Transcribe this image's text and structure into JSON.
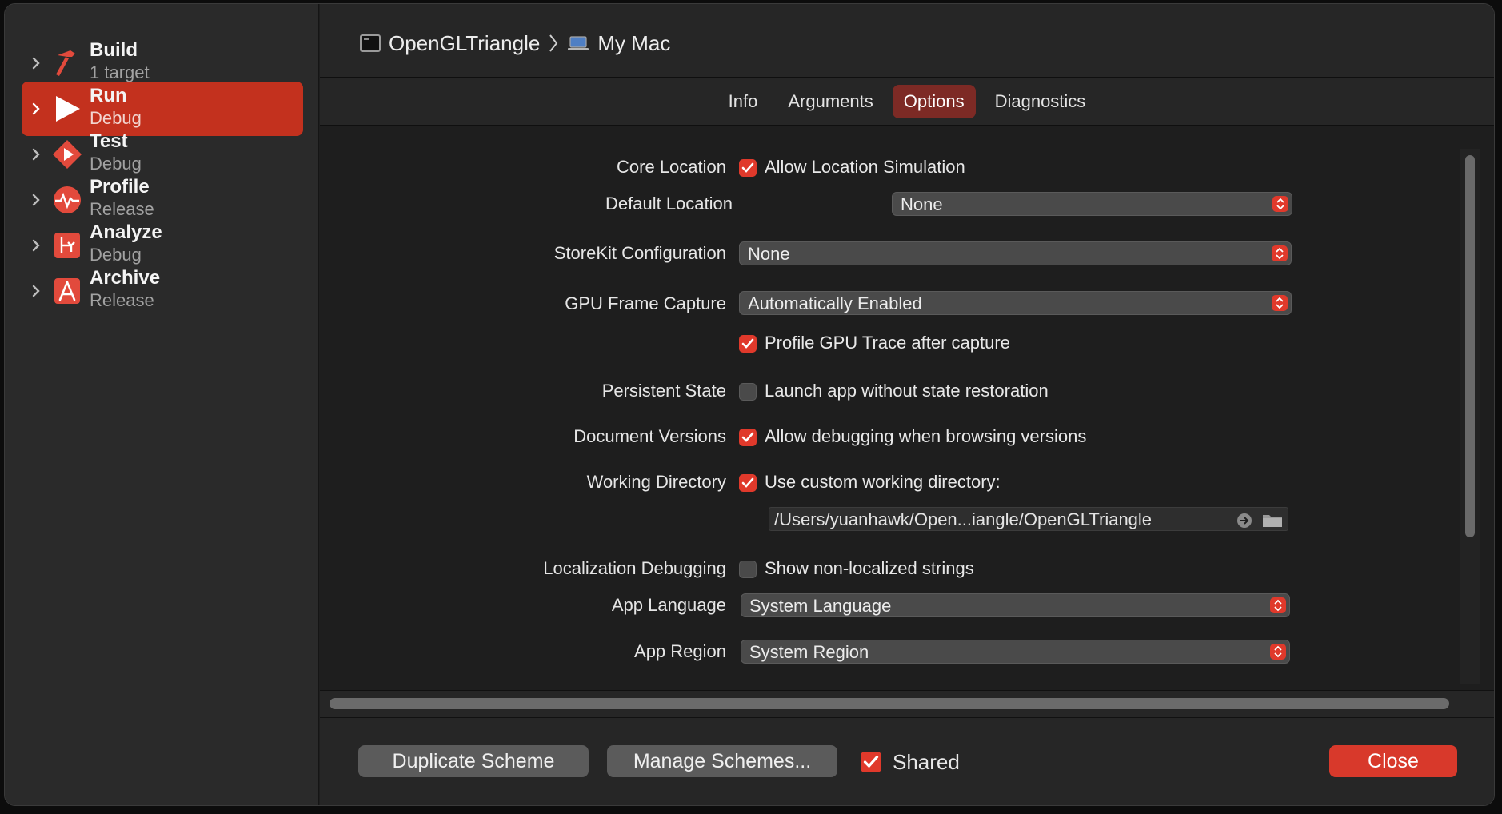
{
  "sidebar": {
    "items": [
      {
        "title": "Build",
        "subtitle": "1 target"
      },
      {
        "title": "Run",
        "subtitle": "Debug"
      },
      {
        "title": "Test",
        "subtitle": "Debug"
      },
      {
        "title": "Profile",
        "subtitle": "Release"
      },
      {
        "title": "Analyze",
        "subtitle": "Debug"
      },
      {
        "title": "Archive",
        "subtitle": "Release"
      }
    ]
  },
  "header": {
    "scheme_name": "OpenGLTriangle",
    "destination": "My Mac"
  },
  "tabs": [
    "Info",
    "Arguments",
    "Options",
    "Diagnostics"
  ],
  "active_tab": "Options",
  "options": {
    "core_location": {
      "label": "Core Location",
      "checkbox_label": "Allow Location Simulation",
      "checked": true,
      "default_location_label": "Default Location",
      "default_location_value": "None"
    },
    "storekit": {
      "label": "StoreKit Configuration",
      "value": "None"
    },
    "gpu_frame_capture": {
      "label": "GPU Frame Capture",
      "value": "Automatically Enabled",
      "checkbox_label": "Profile GPU Trace after capture",
      "checked": true
    },
    "persistent_state": {
      "label": "Persistent State",
      "checkbox_label": "Launch app without state restoration",
      "checked": false
    },
    "document_versions": {
      "label": "Document Versions",
      "checkbox_label": "Allow debugging when browsing versions",
      "checked": true
    },
    "working_directory": {
      "label": "Working Directory",
      "checkbox_label": "Use custom working directory:",
      "checked": true,
      "path": "/Users/yuanhawk/Open...iangle/OpenGLTriangle"
    },
    "localization_debugging": {
      "label": "Localization Debugging",
      "checkbox_label": "Show non-localized strings",
      "checked": false
    },
    "app_language": {
      "label": "App Language",
      "value": "System Language"
    },
    "app_region": {
      "label": "App Region",
      "value": "System Region"
    }
  },
  "footer": {
    "duplicate_label": "Duplicate Scheme",
    "manage_label": "Manage Schemes...",
    "shared_label": "Shared",
    "shared_checked": true,
    "close_label": "Close"
  },
  "colors": {
    "accent": "#e0392b",
    "selected_row": "#c3311e",
    "active_tab": "#7d2a25"
  }
}
